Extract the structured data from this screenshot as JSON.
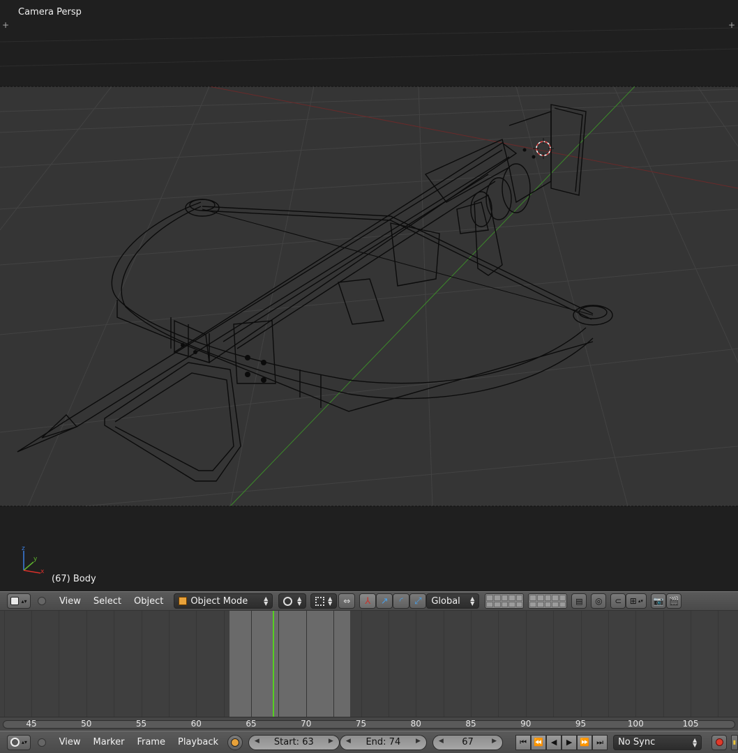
{
  "viewport": {
    "title": "Camera Persp",
    "object_label": "(67) Body",
    "axis_labels": {
      "x": "x",
      "y": "y",
      "z": "z"
    }
  },
  "view3d_header": {
    "menus": [
      "View",
      "Select",
      "Object"
    ],
    "mode": "Object Mode",
    "orientation": "Global"
  },
  "timeline": {
    "ticks": [
      "45",
      "50",
      "55",
      "60",
      "65",
      "70",
      "75",
      "80",
      "85",
      "90",
      "95",
      "100",
      "105"
    ],
    "range_start": 63,
    "range_end": 74,
    "current_frame": 67
  },
  "timeline_header": {
    "menus": [
      "View",
      "Marker",
      "Frame",
      "Playback"
    ],
    "start_label": "Start: 63",
    "end_label": "End: 74",
    "current_label": "67",
    "sync": "No Sync"
  },
  "colors": {
    "viewport_bg": "#272727",
    "grid": "#3a3a3a",
    "x_axis": "#7a2a2a",
    "y_axis": "#3f8a2a",
    "wire": "#0c0c0c",
    "current_frame": "#55d021",
    "record": "#e03a2a"
  },
  "icons": [
    "editor-type-icon",
    "mesh-icon",
    "viewport-shading-icon",
    "pivot-icon",
    "manipulator-icon",
    "translate-icon",
    "rotate-icon",
    "scale-icon",
    "layers-icon",
    "snap-icon",
    "render-icon",
    "clapboard-icon",
    "clock-icon",
    "record-icon"
  ]
}
